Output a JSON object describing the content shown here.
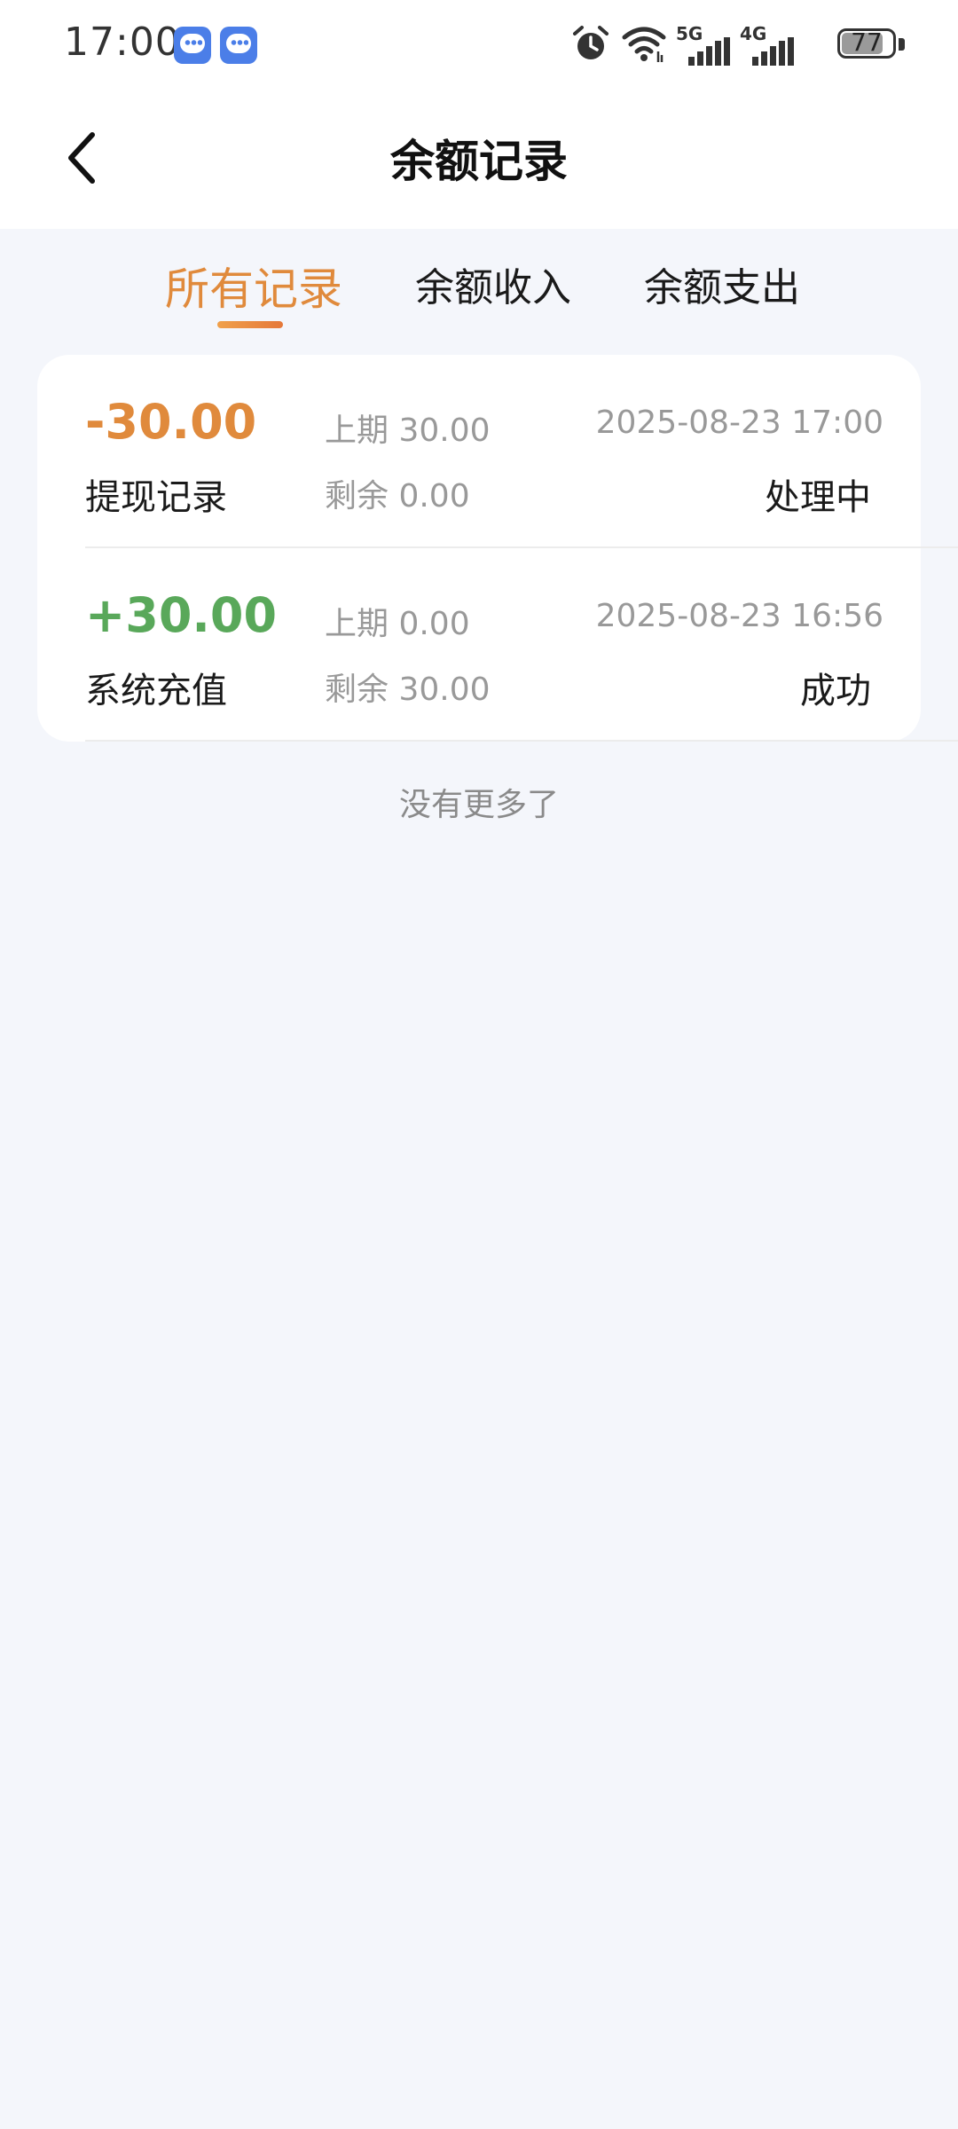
{
  "status_bar": {
    "time": "17:00",
    "battery_level": "77",
    "network_5g": "5G",
    "network_4g": "4G"
  },
  "header": {
    "title": "余额记录"
  },
  "tabs": [
    {
      "label": "所有记录",
      "active": true
    },
    {
      "label": "余额收入",
      "active": false
    },
    {
      "label": "余额支出",
      "active": false
    }
  ],
  "records": [
    {
      "amount": "-30.00",
      "type": "提现记录",
      "prev_balance": "上期 30.00",
      "remaining_balance": "剩余 0.00",
      "timestamp": "2025-08-23 17:00",
      "status": "处理中"
    },
    {
      "amount": "+30.00",
      "type": "系统充值",
      "prev_balance": "上期 0.00",
      "remaining_balance": "剩余 30.00",
      "timestamp": "2025-08-23 16:56",
      "status": "成功"
    }
  ],
  "footer_text": "没有更多了",
  "colors": {
    "accent": "#e08a3c",
    "positive": "#59a85a",
    "background": "#f4f6fb"
  }
}
